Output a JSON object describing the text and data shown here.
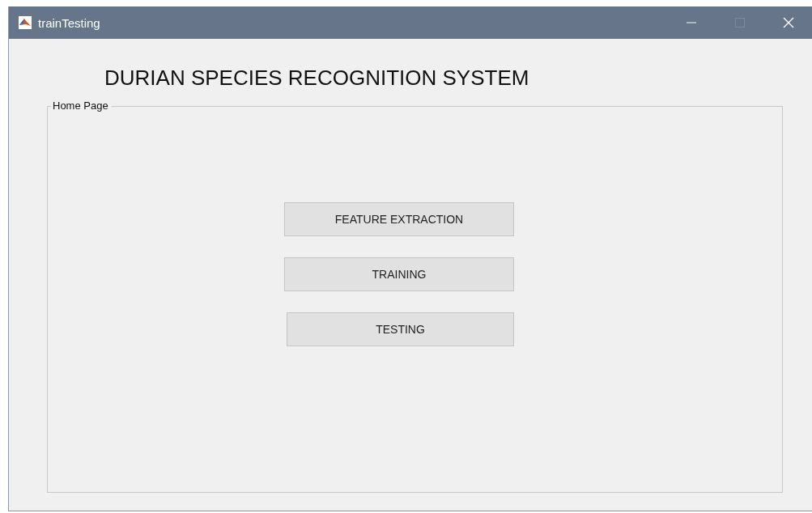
{
  "window": {
    "title": "trainTesting"
  },
  "heading": "DURIAN SPECIES RECOGNITION SYSTEM",
  "panel": {
    "title": "Home Page",
    "buttons": [
      "FEATURE EXTRACTION",
      "TRAINING",
      "TESTING"
    ]
  }
}
